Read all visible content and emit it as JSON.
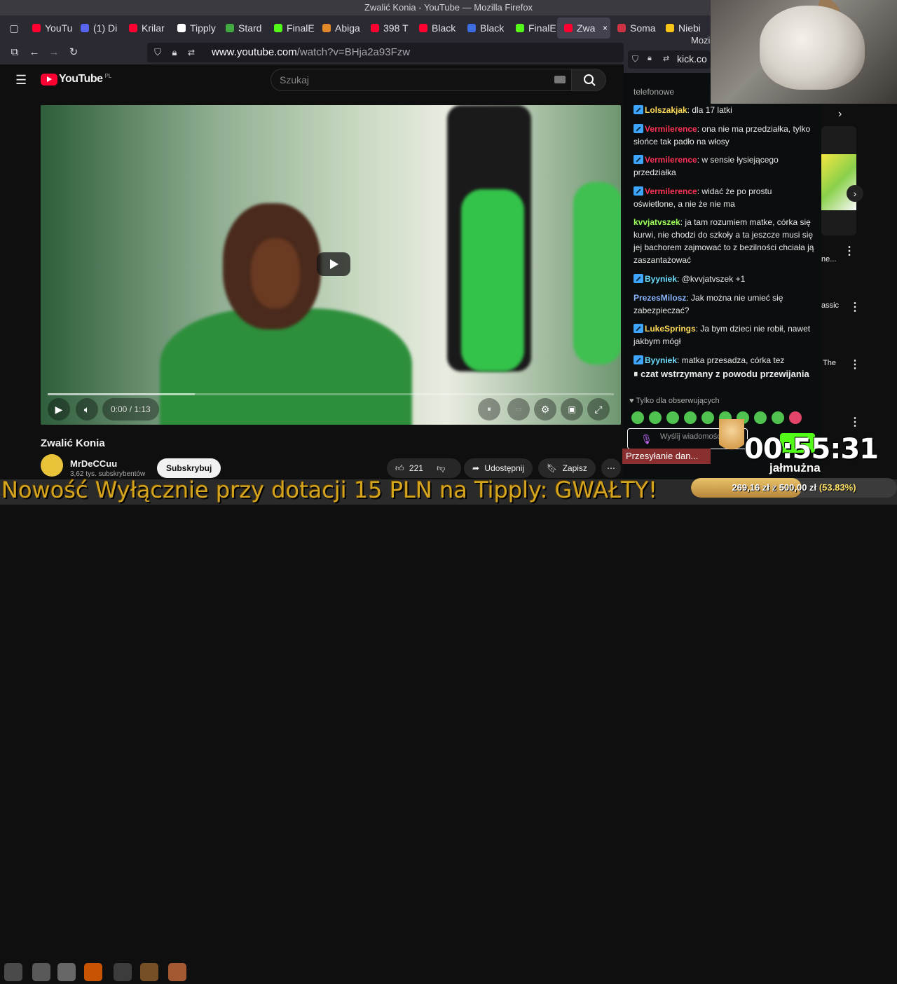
{
  "window": {
    "title": "Zwalić Konia - YouTube — Mozilla Firefox"
  },
  "tabs": [
    {
      "label": "YouTu",
      "color": "#ff0033"
    },
    {
      "label": "(1) Di",
      "color": "#5865f2"
    },
    {
      "label": "Krilar",
      "color": "#ff0033"
    },
    {
      "label": "Tipply",
      "color": "#ffffff"
    },
    {
      "label": "Stard",
      "color": "#44aa44"
    },
    {
      "label": "FinalE",
      "color": "#53fc18"
    },
    {
      "label": "Abiga",
      "color": "#e08a2a"
    },
    {
      "label": "398 T",
      "color": "#ff0033"
    },
    {
      "label": "Black",
      "color": "#ff0033"
    },
    {
      "label": "Black",
      "color": "#3c6ee0"
    },
    {
      "label": "FinalE",
      "color": "#53fc18"
    },
    {
      "label": "Zwa",
      "color": "#ff0033",
      "active": true
    },
    {
      "label": "Soma",
      "color": "#cc3344"
    },
    {
      "label": "Niebi",
      "color": "#f5c518"
    }
  ],
  "toolbar": {
    "url_host": "www.youtube.com",
    "url_path": "/watch?v=BHja2a93Fzw"
  },
  "youtube": {
    "logo": "YouTube",
    "region": "PL",
    "search_placeholder": "Szukaj",
    "video": {
      "time": "0:00 / 1:13"
    },
    "title": "Zwalić Konia",
    "channel": "MrDeCCuu",
    "subscribers": "3,62 tys. subskrybentów",
    "subscribe": "Subskrybuj",
    "likes": "221",
    "share": "Udostępnij",
    "save": "Zapisz"
  },
  "kick": {
    "window_title": "Mozi",
    "url": "kick.co"
  },
  "chat": {
    "cut_line": "telefonowe",
    "messages": [
      {
        "user": "Lolszakjak",
        "color": "#ffd95a",
        "text": "dla 17 latki"
      },
      {
        "user": "Vermilerence",
        "color": "#ff3355",
        "text": "ona nie ma przedziałka, tylko słońce tak padło na włosy"
      },
      {
        "user": "Vermilerence",
        "color": "#ff3355",
        "text": "w sensie łysiejącego przedziałka"
      },
      {
        "user": "Vermilerence",
        "color": "#ff3355",
        "text": "widać że po prostu oświetlone, a nie że nie ma"
      },
      {
        "user": "kvvjatvszek",
        "color": "#9bff5a",
        "text": "ja tam rozumiem matke, córka się kurwi, nie chodzi do szkoły a ta jeszcze musi się jej bachorem zajmować to z bezilności chciała ją zaszantażować"
      },
      {
        "user": "Byyniek",
        "color": "#6ee0ff",
        "text": "@kvvjatvszek +1"
      },
      {
        "user": "PrezesMilosz",
        "color": "#8ab4ff",
        "text": "Jak można nie umieć się zabezpieczać?"
      },
      {
        "user": "LukeSprings",
        "color": "#ffd95a",
        "text": "Ja bym dzieci nie robił, nawet jakbym mógł"
      },
      {
        "user": "Byyniek",
        "color": "#6ee0ff",
        "text": "matka przesadza, córka tez"
      }
    ],
    "paused": "czat wstrzymany z powodu przewijania",
    "followers_only": "Tylko dla obserwujących",
    "send_placeholder": "Wyślij wiadomość...",
    "sending": "Przesyłanie dan..."
  },
  "recommendations": [
    {
      "text": "ne..."
    },
    {
      "text": "assic"
    },
    {
      "text": "The"
    }
  ],
  "stream": {
    "timer": "00:55:31",
    "label": "jałmużna",
    "ticker": "Nowość Wyłącznie przy dotacji 15 PLN na Tipply: GWAŁTY!",
    "goal_amount": "269,16 zł",
    "goal_of": "z",
    "goal_target": "500,00 zł",
    "goal_percent": "(53.83%)",
    "goal_fraction": 0.5383
  }
}
